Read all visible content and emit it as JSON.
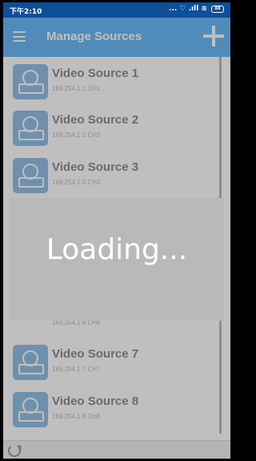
{
  "status_bar": {
    "time": "下午2:10",
    "icons": "... ♡ .ıll ≋"
  },
  "battery": "88",
  "app_bar": {
    "title": "Manage Sources",
    "menu_icon": "hamburger-menu-icon",
    "add_icon": "plus-icon"
  },
  "sources": [
    {
      "name": "Video Source 1",
      "detail": "169.254.1.1  CH1"
    },
    {
      "name": "Video Source 2",
      "detail": "169.254.1.2  CH2"
    },
    {
      "name": "Video Source 3",
      "detail": "169.254.1.3  CH3"
    },
    {
      "name": "",
      "detail": ""
    },
    {
      "name": "",
      "detail": "169.254.1.6  CH6"
    },
    {
      "name": "Video Source 7",
      "detail": "169.254.1.7  CH7"
    },
    {
      "name": "Video Source 8",
      "detail": "169.254.1.8  CH8"
    }
  ],
  "loading": {
    "text": "Loading..."
  },
  "bottom_bar": {
    "refresh_icon": "refresh-icon"
  },
  "colors": {
    "app_bar": "#2196f3",
    "status_bar": "#0d4f9a",
    "thumb": "#5ea0d8"
  }
}
